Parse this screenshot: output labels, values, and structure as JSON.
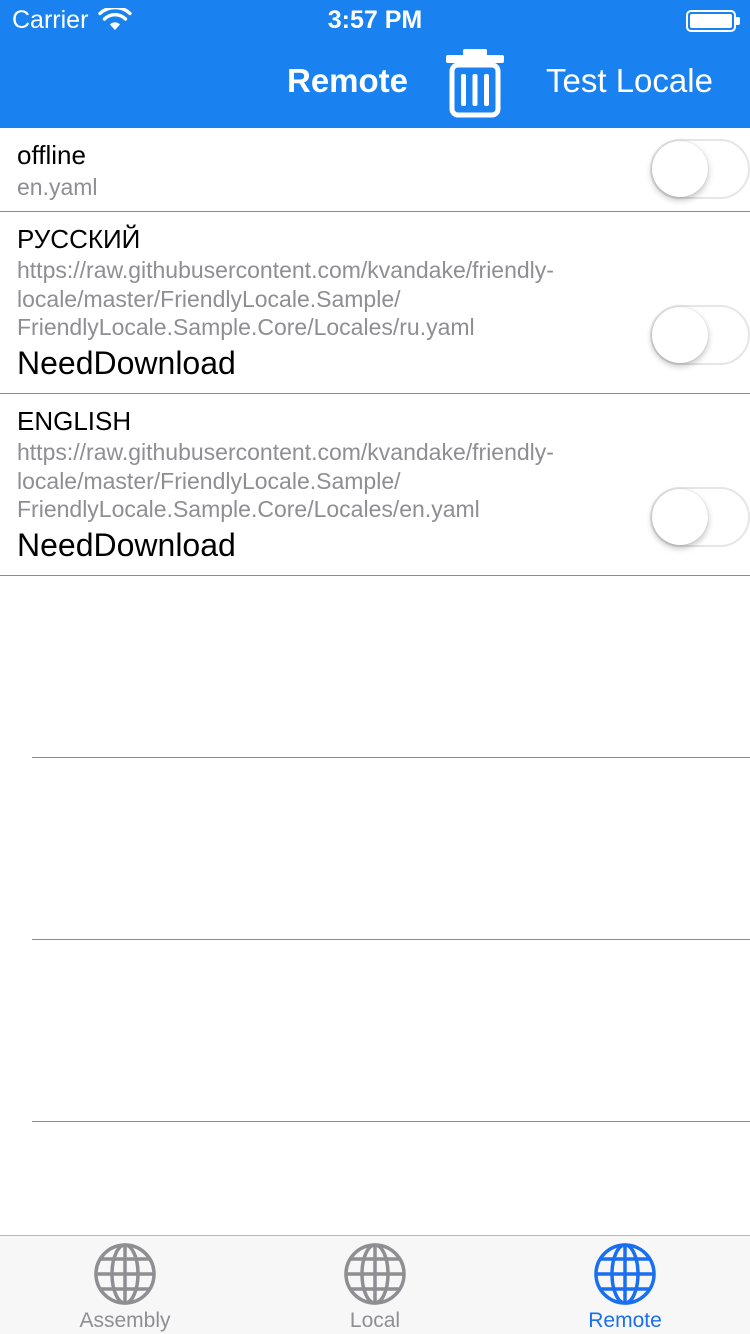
{
  "status_bar": {
    "carrier": "Carrier",
    "time": "3:57 PM"
  },
  "nav": {
    "left_title": "Remote",
    "trash_icon": "trash-icon",
    "right_button": "Test Locale"
  },
  "list": {
    "items": [
      {
        "title": "offline",
        "subtitle": "en.yaml",
        "toggle_on": false
      },
      {
        "title": "РУССКИЙ",
        "url_lines": [
          "https://raw.githubusercontent.com/kvandake/friendly-",
          "locale/master/FriendlyLocale.Sample/",
          "FriendlyLocale.Sample.Core/Locales/ru.yaml"
        ],
        "status": "NeedDownload",
        "toggle_on": false
      },
      {
        "title": "ENGLISH",
        "url_lines": [
          "https://raw.githubusercontent.com/kvandake/friendly-",
          "locale/master/FriendlyLocale.Sample/",
          "FriendlyLocale.Sample.Core/Locales/en.yaml"
        ],
        "status": "NeedDownload",
        "toggle_on": false
      }
    ]
  },
  "tabs": [
    {
      "label": "Assembly",
      "icon": "globe-icon",
      "active": false
    },
    {
      "label": "Local",
      "icon": "globe-icon",
      "active": false
    },
    {
      "label": "Remote",
      "icon": "globe-icon",
      "active": true
    }
  ],
  "colors": {
    "nav_bar": "#1a82f0",
    "tab_active": "#1a6ff0",
    "tab_inactive": "#8e8e93"
  }
}
